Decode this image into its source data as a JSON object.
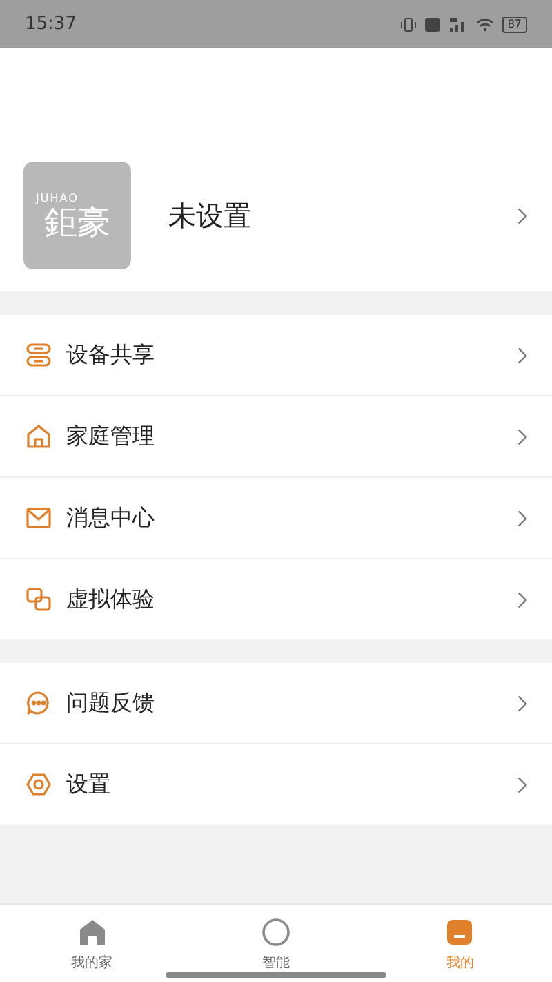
{
  "status_bar": {
    "time": "15:37",
    "battery": "87"
  },
  "profile": {
    "logo_latin": "JUHAO",
    "logo_han": "鉅豪",
    "name": "未设置"
  },
  "menu_groups": [
    {
      "items": [
        {
          "label": "设备共享",
          "kind": "share"
        },
        {
          "label": "家庭管理",
          "kind": "home"
        },
        {
          "label": "消息中心",
          "kind": "mail"
        },
        {
          "label": "虚拟体验",
          "kind": "virtual"
        }
      ]
    },
    {
      "items": [
        {
          "label": "问题反馈",
          "kind": "feedback"
        },
        {
          "label": "设置",
          "kind": "settings"
        }
      ]
    }
  ],
  "tabs": [
    {
      "label": "我的家",
      "kind": "home",
      "selected": false
    },
    {
      "label": "智能",
      "kind": "smart",
      "selected": false
    },
    {
      "label": "我的",
      "kind": "me",
      "selected": true
    }
  ]
}
